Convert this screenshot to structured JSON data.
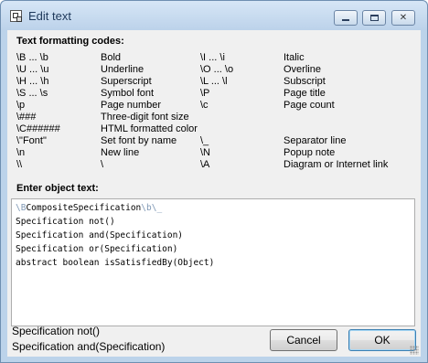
{
  "window": {
    "title": "Edit text",
    "buttons": {
      "minimize_icon": "minimize-icon",
      "maximize_icon": "maximize-icon",
      "close_icon": "close-icon",
      "close_glyph": "✕"
    }
  },
  "codes": {
    "heading": "Text formatting codes:",
    "rows": [
      {
        "code1": "\\B ... \\b",
        "desc1": "Bold",
        "code2": "\\I ... \\i",
        "desc2": "Italic"
      },
      {
        "code1": "\\U ... \\u",
        "desc1": "Underline",
        "code2": "\\O ... \\o",
        "desc2": "Overline"
      },
      {
        "code1": "\\H ... \\h",
        "desc1": "Superscript",
        "code2": "\\L ... \\l",
        "desc2": "Subscript"
      },
      {
        "code1": "\\S ... \\s",
        "desc1": "Symbol font",
        "code2": "\\P",
        "desc2": "Page title"
      },
      {
        "code1": "\\p",
        "desc1": "Page number",
        "code2": "\\c",
        "desc2": "Page count"
      },
      {
        "code1": "\\###",
        "desc1": "Three-digit font size",
        "code2": "",
        "desc2": ""
      },
      {
        "code1": "\\C######",
        "desc1": "HTML formatted color",
        "code2": "",
        "desc2": ""
      },
      {
        "code1": "\\\"Font\"",
        "desc1": "Set font by name",
        "code2": "\\_",
        "desc2": "Separator line"
      },
      {
        "code1": "\\n",
        "desc1": "New line",
        "code2": "\\N",
        "desc2": "Popup note"
      },
      {
        "code1": "\\\\",
        "desc1": "\\",
        "code2": "\\A",
        "desc2": "Diagram or Internet link"
      }
    ]
  },
  "editor": {
    "heading": "Enter object text:",
    "line1": {
      "pre": "\\B",
      "name": "CompositeSpecification",
      "post": "\\b\\_"
    },
    "lines": [
      "Specification not()",
      "Specification and(Specification)",
      "Specification or(Specification)",
      "abstract boolean isSatisfiedBy(Object)"
    ]
  },
  "preview": {
    "line1": "Specification not()",
    "line2": "Specification and(Specification)"
  },
  "dialog_buttons": {
    "cancel": "Cancel",
    "ok": "OK"
  },
  "colors": {
    "titlebar": "#bcd3ea",
    "client": "#f0f0f0",
    "code_highlight": "#7f98b5"
  }
}
